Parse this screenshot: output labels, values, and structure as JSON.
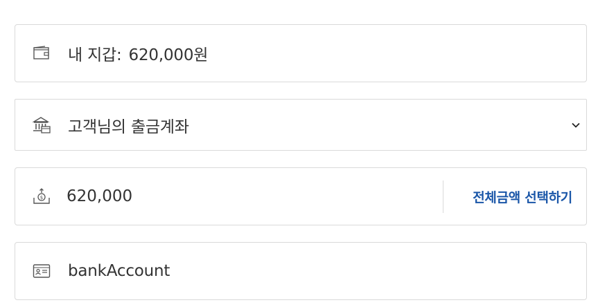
{
  "wallet": {
    "label": "내 지갑:",
    "balance": "620,000원",
    "icon": "wallet-icon"
  },
  "account_select": {
    "selected": "고객님의 출금계좌",
    "icon": "bank-icon",
    "chevron": "chevron-down-icon"
  },
  "amount": {
    "value": "620,000",
    "icon": "money-upload-icon",
    "select_all_label": "전체금액 선택하기"
  },
  "bank_account": {
    "value": "bankAccount",
    "icon": "id-card-icon"
  },
  "colors": {
    "accent": "#1a56a8",
    "border": "#d9d9d9",
    "text": "#333333"
  }
}
